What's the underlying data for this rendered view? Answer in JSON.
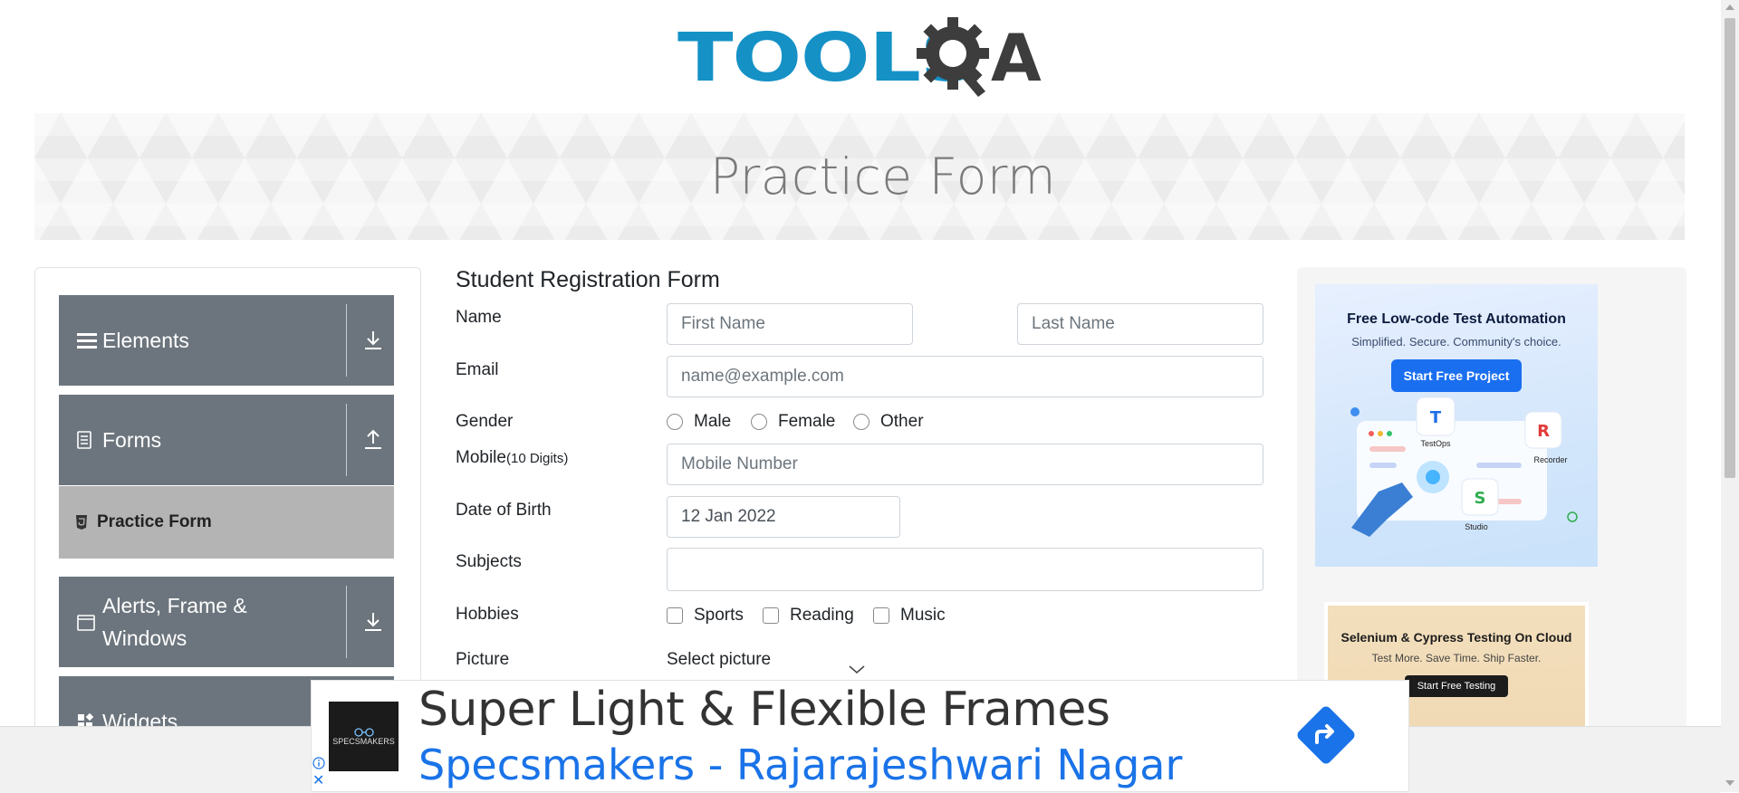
{
  "logo": {
    "text": "TOOLS",
    "text_end": "A",
    "text_color": "#1591c6",
    "gear_color": "#3d3d3d"
  },
  "banner": {
    "title": "Practice Form"
  },
  "sidebar": {
    "groups": [
      {
        "label": "Elements",
        "icon": "hamburger-icon",
        "arrow": "download-arrow-icon"
      },
      {
        "label": "Forms",
        "icon": "document-icon",
        "arrow": "upload-arrow-icon"
      },
      {
        "label": "Alerts, Frame & Windows",
        "icon": "window-icon",
        "arrow": "download-arrow-icon"
      },
      {
        "label": "Widgets",
        "icon": "widgets-icon"
      }
    ],
    "active_item": {
      "label": "Practice Form",
      "icon": "html5-icon"
    }
  },
  "form": {
    "title": "Student Registration Form",
    "name_label": "Name",
    "first_name_placeholder": "First Name",
    "last_name_placeholder": "Last Name",
    "email_label": "Email",
    "email_placeholder": "name@example.com",
    "gender_label": "Gender",
    "gender_options": [
      "Male",
      "Female",
      "Other"
    ],
    "mobile_label": "Mobile",
    "mobile_hint": "(10 Digits)",
    "mobile_placeholder": "Mobile Number",
    "dob_label": "Date of Birth",
    "dob_value": "12 Jan 2022",
    "subjects_label": "Subjects",
    "hobbies_label": "Hobbies",
    "hobby_options": [
      "Sports",
      "Reading",
      "Music"
    ],
    "picture_label": "Picture",
    "picture_button": "Select picture"
  },
  "ads": {
    "right_top": {
      "title": "Free Low-code Test Automation",
      "subtitle": "Simplified. Secure. Community's choice.",
      "button": "Start Free Project",
      "items": [
        "TestOps",
        "Recorder",
        "Studio"
      ]
    },
    "right_bottom": {
      "title": "Selenium & Cypress Testing On Cloud",
      "subtitle": "Test More. Save Time. Ship Faster.",
      "button": "Start Free Testing"
    },
    "bottom": {
      "title": "Super Light & Flexible Frames",
      "subtitle": "Specsmakers - Rajarajeshwari Nagar",
      "logo_text": "SPECSMAKERS"
    }
  },
  "colors": {
    "sidebar_group": "#6c757d",
    "sidebar_active": "#b4b4b4",
    "accent_blue": "#1a73e8"
  }
}
